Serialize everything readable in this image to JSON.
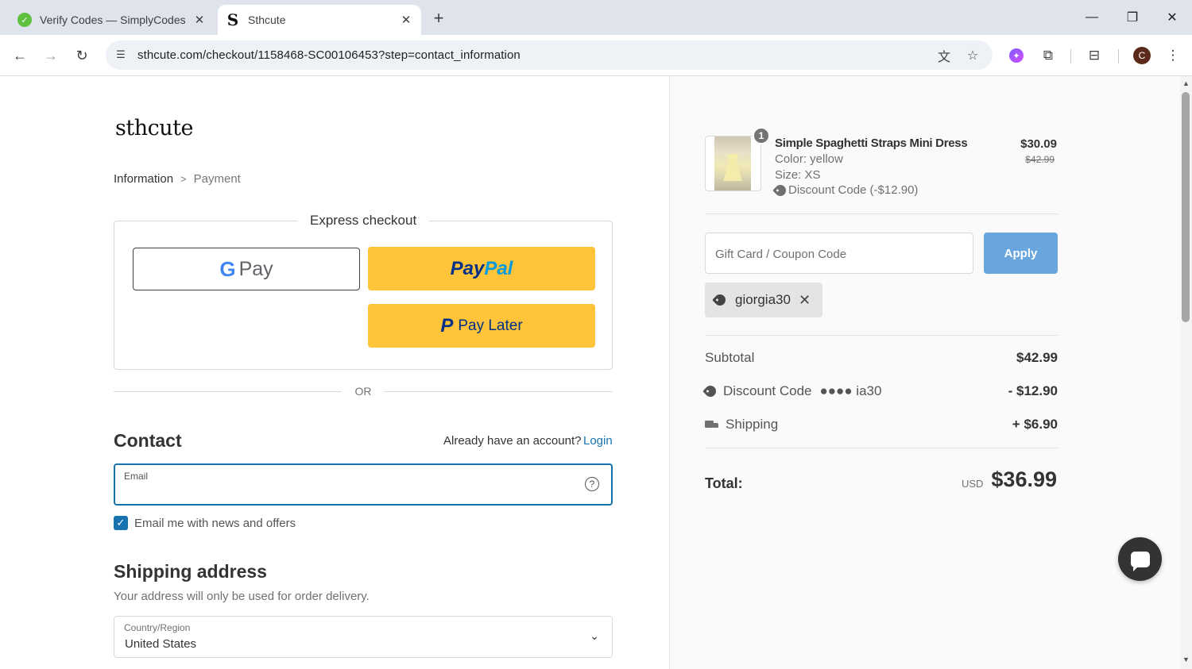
{
  "browser": {
    "tabs": [
      {
        "title": "Verify Codes — SimplyCodes",
        "favicon": "check-icon",
        "active": false
      },
      {
        "title": "Sthcute",
        "favicon": "S",
        "active": true
      }
    ],
    "url": "sthcute.com/checkout/1158468-SC00106453?step=contact_information",
    "profile_initial": "C"
  },
  "store": {
    "logo": "sthcute"
  },
  "breadcrumb": {
    "current": "Information",
    "next": "Payment"
  },
  "express": {
    "title": "Express checkout",
    "gpay_text": "Pay",
    "paypal_part1": "Pay",
    "paypal_part2": "Pal",
    "paylater_text": "Pay Later"
  },
  "divider_text": "OR",
  "contact": {
    "heading": "Contact",
    "account_prompt": "Already have an account?",
    "login_label": "Login",
    "email_label": "Email",
    "email_value": "",
    "newsletter_label": "Email me with news and offers",
    "newsletter_checked": true
  },
  "shipping": {
    "heading": "Shipping address",
    "subtext": "Your address will only be used for order delivery.",
    "country_label": "Country/Region",
    "country_value": "United States"
  },
  "summary": {
    "product": {
      "name": "Simple Spaghetti Straps Mini Dress",
      "color": "Color: yellow",
      "size": "Size: XS",
      "discount": "Discount Code (-$12.90)",
      "price": "$30.09",
      "original_price": "$42.99",
      "quantity": "1"
    },
    "coupon_placeholder": "Gift Card / Coupon Code",
    "apply_label": "Apply",
    "applied_code": "giorgia30",
    "subtotal_label": "Subtotal",
    "subtotal_value": "$42.99",
    "discount_label": "Discount Code",
    "discount_code_mask": "●●●● ia30",
    "discount_value": "- $12.90",
    "shipping_label": "Shipping",
    "shipping_value": "+ $6.90",
    "total_label": "Total:",
    "currency": "USD",
    "total_value": "$36.99"
  },
  "colors": {
    "accent": "#1773b0",
    "paypal_yellow": "#ffc439",
    "apply_button": "#6aa6de"
  }
}
